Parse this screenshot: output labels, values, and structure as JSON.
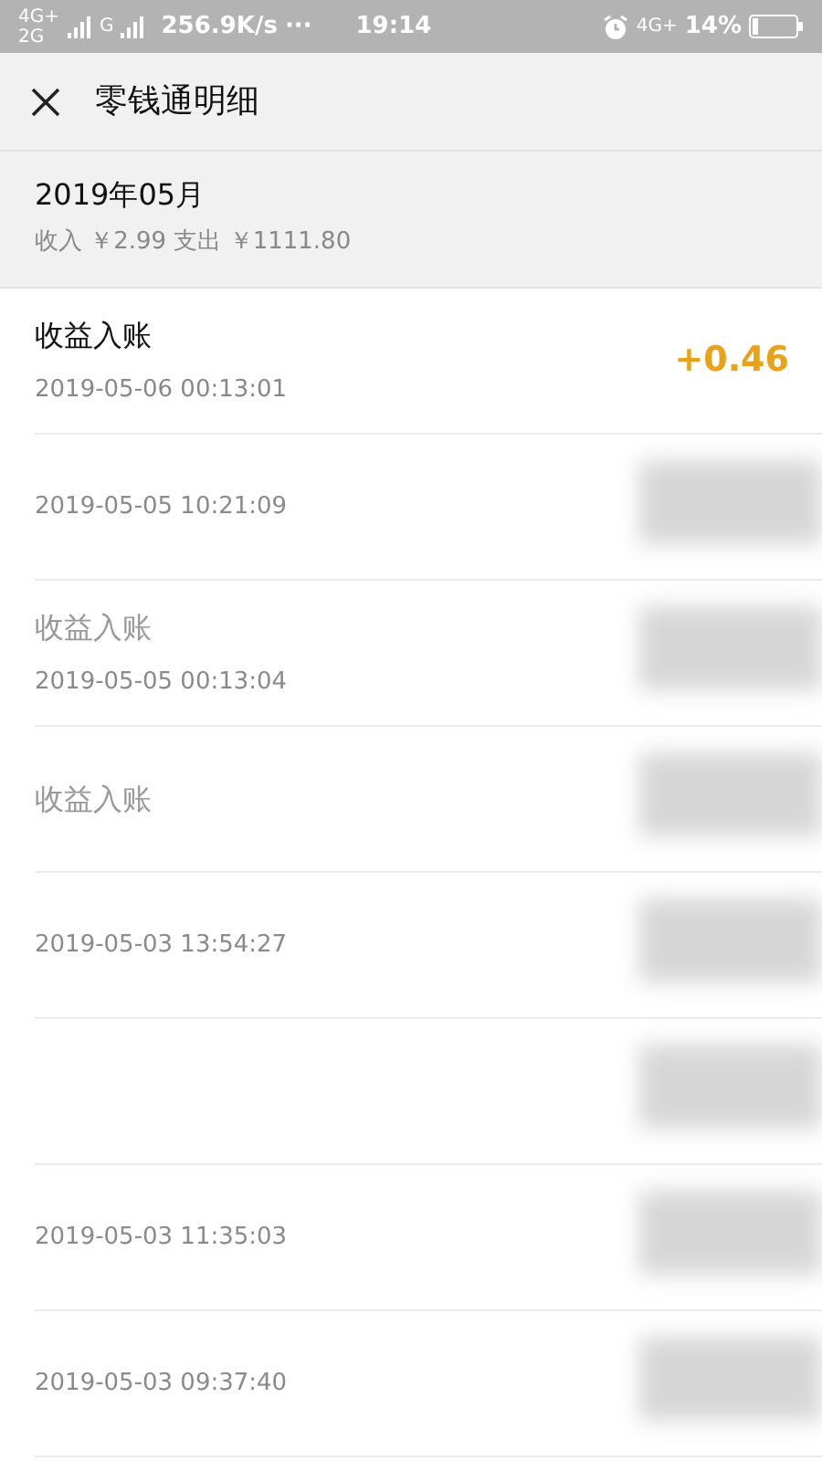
{
  "status_bar": {
    "network_top": "4G+",
    "network_bottom": "2G",
    "network_2": "G",
    "speed": "256.9K/s",
    "more": "···",
    "time": "19:14",
    "network_right": "4G+",
    "battery": "14%"
  },
  "header": {
    "title": "零钱通明细"
  },
  "month": {
    "title": "2019年05月",
    "summary": "收入 ￥2.99 支出 ￥1111.80"
  },
  "rows": [
    {
      "title": "收益入账",
      "time": "2019-05-06 00:13:01",
      "amount": "+0.46",
      "obscured": false
    },
    {
      "time": "2019-05-05 10:21:09",
      "obscured": true
    },
    {
      "title": "收益入账",
      "time": "2019-05-05 00:13:04",
      "obscured": true
    },
    {
      "title": "收益入账",
      "obscured": true
    },
    {
      "time": "2019-05-03 13:54:27",
      "obscured": true
    },
    {
      "obscured": true
    },
    {
      "time": "2019-05-03 11:35:03",
      "obscured": true
    },
    {
      "time": "2019-05-03 09:37:40",
      "obscured": true
    }
  ]
}
